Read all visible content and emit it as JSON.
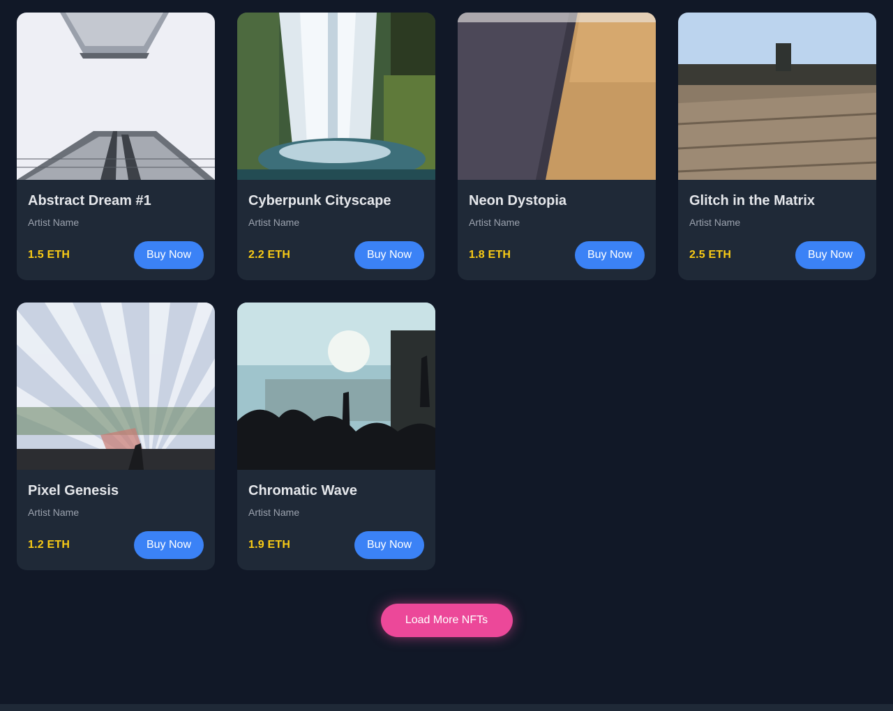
{
  "colors": {
    "background": "#111827",
    "card": "#1f2937",
    "price": "#facc15",
    "buy_button": "#3b82f6",
    "load_button": "#ec4899"
  },
  "nfts": [
    {
      "title": "Abstract Dream #1",
      "artist": "Artist Name",
      "price": "1.5 ETH",
      "button": "Buy Now",
      "image": "skyscraper-photo"
    },
    {
      "title": "Cyberpunk Cityscape",
      "artist": "Artist Name",
      "price": "2.2 ETH",
      "button": "Buy Now",
      "image": "waterfall-photo"
    },
    {
      "title": "Neon Dystopia",
      "artist": "Artist Name",
      "price": "1.8 ETH",
      "button": "Buy Now",
      "image": "road-sand-photo"
    },
    {
      "title": "Glitch in the Matrix",
      "artist": "Artist Name",
      "price": "2.5 ETH",
      "button": "Buy Now",
      "image": "boardwalk-photo"
    },
    {
      "title": "Pixel Genesis",
      "artist": "Artist Name",
      "price": "1.2 ETH",
      "button": "Buy Now",
      "image": "light-beams-photo"
    },
    {
      "title": "Chromatic Wave",
      "artist": "Artist Name",
      "price": "1.9 ETH",
      "button": "Buy Now",
      "image": "concert-crowd-photo"
    }
  ],
  "load_more": {
    "label": "Load More NFTs"
  }
}
